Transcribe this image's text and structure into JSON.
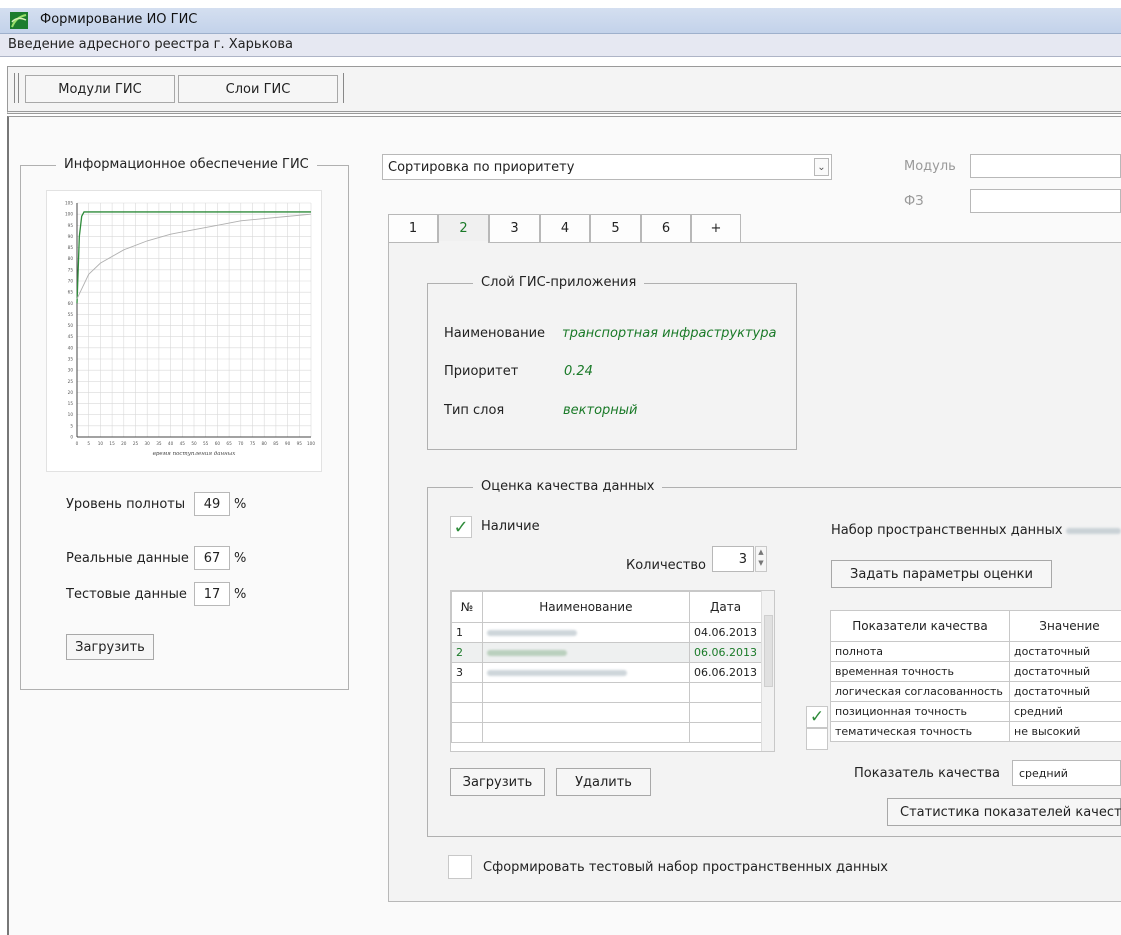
{
  "app": {
    "title": "Формирование ИО ГИС",
    "subtitle": "Введение адресного реестра г. Харькова"
  },
  "toolbar": {
    "modules_label": "Модули ГИС",
    "layers_label": "Слои ГИС"
  },
  "info_panel": {
    "legend": "Информационное обеспечение ГИС",
    "chart_xlabel": "время поступления данных",
    "completeness_label": "Уровень полноты",
    "completeness_value": "49",
    "real_label": "Реальные данные",
    "real_value": "67",
    "test_label": "Тестовые данные",
    "test_value": "17",
    "percent": "%",
    "load_label": "Загрузить"
  },
  "chart_data": {
    "type": "line",
    "xlabel": "время поступления данных",
    "ylabel": "",
    "xlim": [
      0,
      100
    ],
    "ylim": [
      0,
      105
    ],
    "x_ticks": [
      0,
      5,
      10,
      15,
      20,
      25,
      30,
      35,
      40,
      45,
      50,
      55,
      60,
      65,
      70,
      75,
      80,
      85,
      90,
      95,
      100
    ],
    "y_ticks": [
      0,
      5,
      10,
      15,
      20,
      25,
      30,
      35,
      40,
      45,
      50,
      55,
      60,
      65,
      70,
      75,
      80,
      85,
      90,
      95,
      100,
      105
    ],
    "series": [
      {
        "color": "#2e8b3a",
        "x": [
          0,
          1,
          2,
          3,
          100
        ],
        "y": [
          60,
          90,
          99,
          101,
          101
        ]
      },
      {
        "color": "#b0b0b0",
        "x": [
          0,
          5,
          10,
          20,
          30,
          40,
          50,
          60,
          70,
          80,
          90,
          100
        ],
        "y": [
          62,
          73,
          78,
          84,
          88,
          91,
          93,
          95,
          97,
          98,
          99,
          100
        ]
      }
    ],
    "grid": true
  },
  "sort": {
    "value": "Сортировка по приоритету",
    "module_label": "Модуль",
    "fz_label": "ФЗ"
  },
  "tabs": [
    "1",
    "2",
    "3",
    "4",
    "5",
    "6",
    "+"
  ],
  "layer": {
    "legend": "Слой ГИС-приложения",
    "name_label": "Наименование",
    "name_value": "транспортная инфраструктура",
    "priority_label": "Приоритет",
    "priority_value": "0.24",
    "type_label": "Тип слоя",
    "type_value": "векторный"
  },
  "quality": {
    "legend": "Оценка качества данных",
    "availability_label": "Наличие",
    "count_label": "Количество",
    "count_value": "3",
    "dataset_label": "Набор пространственных данных",
    "set_params_label": "Задать параметры оценки",
    "sources": {
      "headers": [
        "№",
        "Наименование",
        "Дата"
      ],
      "rows": [
        {
          "num": "1",
          "date": "04.06.2013"
        },
        {
          "num": "2",
          "date": "06.06.2013"
        },
        {
          "num": "3",
          "date": "06.06.2013"
        }
      ]
    },
    "load_label": "Загрузить",
    "delete_label": "Удалить",
    "indicators": {
      "headers": [
        "Показатели качества",
        "Значение"
      ],
      "rows": [
        {
          "name": "полнота",
          "value": "достаточный"
        },
        {
          "name": "временная точность",
          "value": "достаточный"
        },
        {
          "name": "логическая согласованность",
          "value": "достаточный"
        },
        {
          "name": "позиционная точность",
          "value": "средний"
        },
        {
          "name": "тематическая точность",
          "value": "не высокий"
        }
      ]
    },
    "indicator_label": "Показатель качества",
    "indicator_value": "средний",
    "stats_label": "Статистика показателей качества"
  },
  "test_set_label": "Сформировать тестовый набор пространственных данных"
}
